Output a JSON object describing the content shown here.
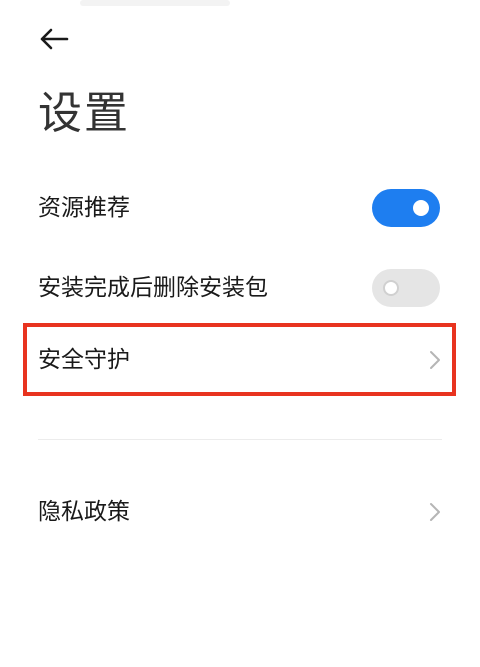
{
  "header": {
    "back_icon": "arrow-left-icon",
    "title": "设置"
  },
  "settings": {
    "resource_recommend": {
      "label": "资源推荐",
      "enabled": true
    },
    "delete_after_install": {
      "label": "安装完成后删除安装包",
      "enabled": false
    },
    "security_protection": {
      "label": "安全守护",
      "icon": "chevron-right-icon"
    },
    "privacy_policy": {
      "label": "隐私政策",
      "icon": "chevron-right-icon"
    }
  },
  "colors": {
    "toggle_on": "#1e7ef0",
    "toggle_off": "#e5e5e5",
    "highlight": "#e8331f",
    "text": "#1a1a1a",
    "chevron": "#b5b5b5"
  }
}
